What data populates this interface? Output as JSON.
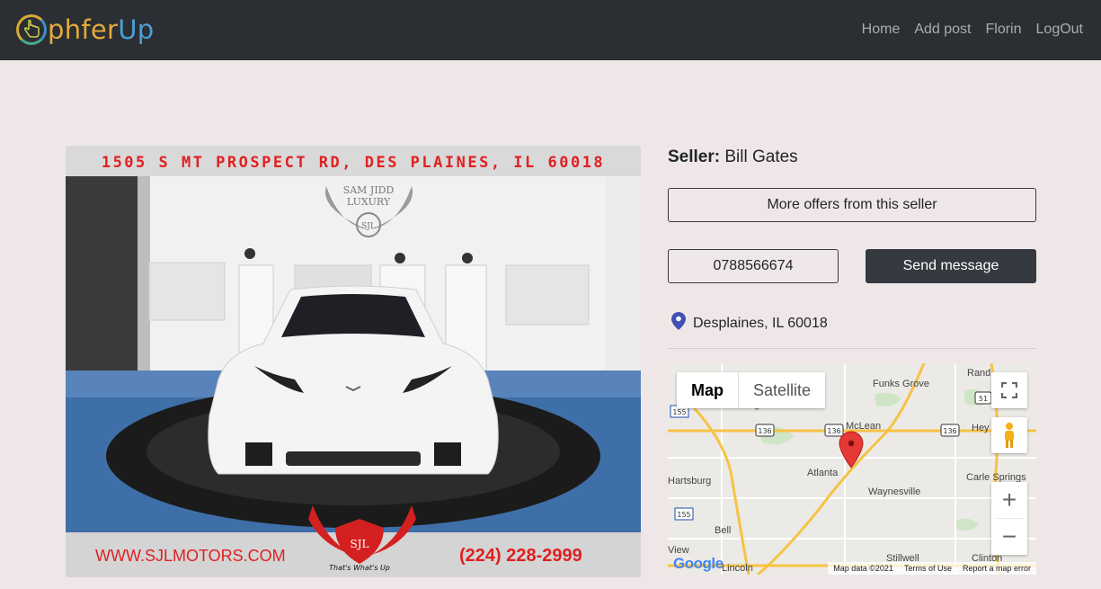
{
  "brand": {
    "name_prefix": "phfer",
    "name_suffix": "Up"
  },
  "nav": {
    "items": [
      "Home",
      "Add post",
      "Florin",
      "LogOut"
    ]
  },
  "listing_image": {
    "top_banner": "1505 S MT PROSPECT RD, DES PLAINES, IL 60018",
    "wall_sign_line1": "SAM JIDD",
    "wall_sign_line2": "LUXURY",
    "wall_sign_monogram": "SJL",
    "bottom_website": "WWW.SJLMOTORS.COM",
    "bottom_phone": "(224) 228-2999",
    "logo_monogram": "SJL",
    "logo_tagline": "That's What's Up"
  },
  "seller": {
    "label": "Seller:",
    "name": "Bill Gates"
  },
  "buttons": {
    "more_offers": "More offers from this seller",
    "phone": "0788566674",
    "send_message": "Send message"
  },
  "location": {
    "text": "Desplaines, IL 60018"
  },
  "map": {
    "map_label": "Map",
    "satellite_label": "Satellite",
    "place_labels": {
      "rand": "Rand",
      "funks_grove": "Funks Grove",
      "farmington": "Farmington",
      "mclean": "McLean",
      "hey": "Hey",
      "atlanta": "Atlanta",
      "carle_springs": "Carle Springs",
      "hartsburg": "Hartsburg",
      "waynesville": "Waynesville",
      "bell": "Bell",
      "view": "View",
      "lincoln": "Lincoln",
      "clinton": "Clinton",
      "stillwell": "Stillwell"
    },
    "road_shields": [
      "155",
      "136",
      "136",
      "136",
      "51",
      "155"
    ],
    "google": "Google",
    "footer": [
      "Map data ©2021",
      "Terms of Use",
      "Report a map error"
    ],
    "colors": {
      "marker": "#e53935",
      "road_major": "#f6c343",
      "land": "#eceae6",
      "park": "#c8e6c0"
    }
  }
}
